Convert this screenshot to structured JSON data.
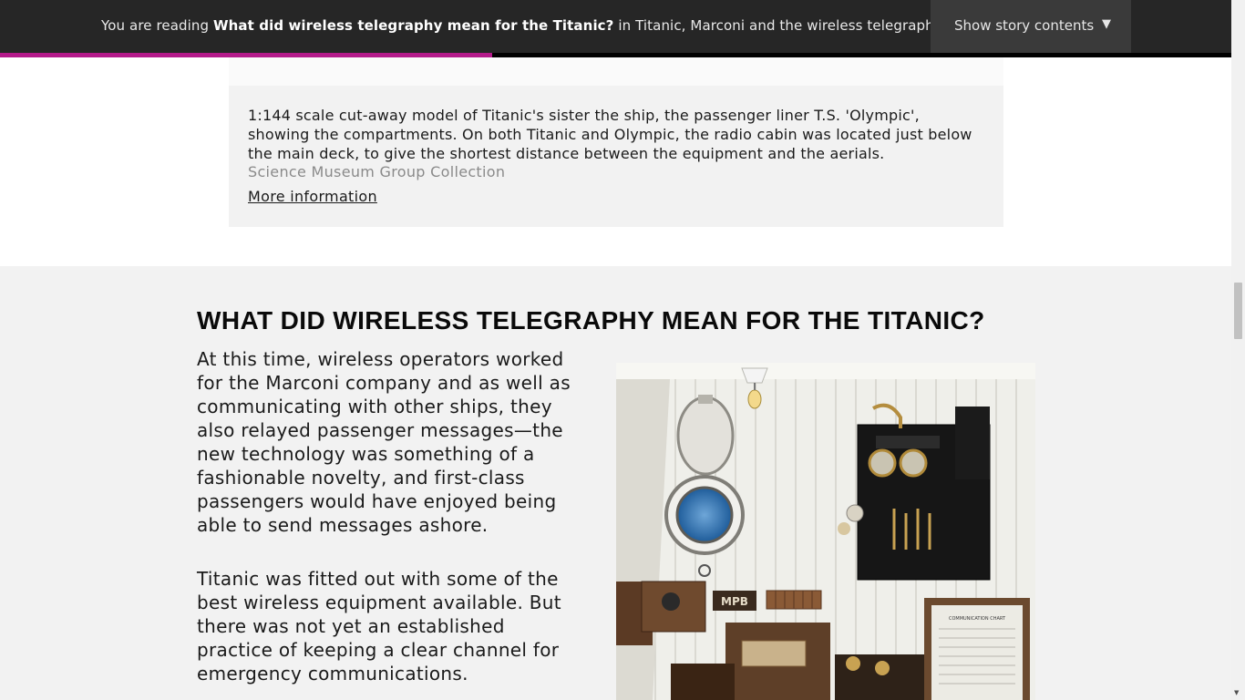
{
  "topbar": {
    "reading_prefix": "You are reading",
    "story_title": "What did wireless telegraphy mean for the Titanic?",
    "reading_in": "in",
    "collection_title": "Titanic, Marconi and the wireless telegraph",
    "contents_button": "Show story contents",
    "contents_arrow": "▼",
    "progress_fraction": 0.4
  },
  "caption": {
    "text": "1:144 scale cut-away model of Titanic's sister the ship, the passenger liner T.S. 'Olympic', showing the compartments. On both Titanic and Olympic, the radio cabin was located just below the main deck, to give the shortest distance between the equipment and the aerials.",
    "credit": "Science Museum Group Collection",
    "more_link": "More information"
  },
  "section": {
    "heading": "WHAT DID WIRELESS TELEGRAPHY MEAN FOR THE TITANIC?",
    "paragraphs": [
      "At this time, wireless operators worked for the Marconi company and as well as communicating with other ships, they also relayed passenger messages—the new technology was something of a fashionable novelty, and first-class passengers would have enjoyed being able to send messages ashore.",
      "Titanic was fitted out with some of the best wireless equipment available. But there was not yet an established practice of keeping a clear channel for emergency communications."
    ],
    "photo": {
      "sign_text": "MPB",
      "chart_text": "COMMUNICATION CHART"
    }
  },
  "colors": {
    "topbar_bg": "#262626",
    "progress_accent": "#b41a8a",
    "section_bg": "#f2f2f2"
  }
}
